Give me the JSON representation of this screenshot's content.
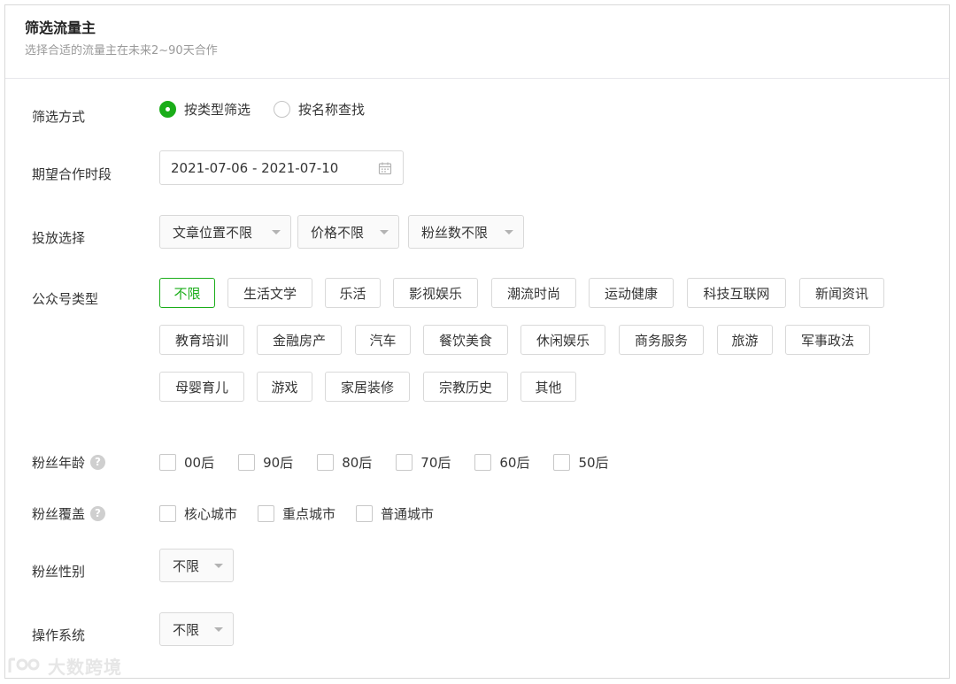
{
  "header": {
    "title": "筛选流量主",
    "subtitle": "选择合适的流量主在未来2~90天合作"
  },
  "filter_method": {
    "label": "筛选方式",
    "options": [
      {
        "label": "按类型筛选",
        "selected": true
      },
      {
        "label": "按名称查找",
        "selected": false
      }
    ]
  },
  "period": {
    "label": "期望合作时段",
    "value": "2021-07-06 - 2021-07-10",
    "icon": "calendar-icon"
  },
  "placement": {
    "label": "投放选择",
    "selects": [
      {
        "label": "文章位置不限"
      },
      {
        "label": "价格不限"
      },
      {
        "label": "粉丝数不限"
      }
    ]
  },
  "account_type": {
    "label": "公众号类型",
    "tags": [
      {
        "label": "不限",
        "active": true
      },
      {
        "label": "生活文学"
      },
      {
        "label": "乐活"
      },
      {
        "label": "影视娱乐"
      },
      {
        "label": "潮流时尚"
      },
      {
        "label": "运动健康"
      },
      {
        "label": "科技互联网"
      },
      {
        "label": "新闻资讯"
      },
      {
        "label": "教育培训"
      },
      {
        "label": "金融房产"
      },
      {
        "label": "汽车"
      },
      {
        "label": "餐饮美食"
      },
      {
        "label": "休闲娱乐"
      },
      {
        "label": "商务服务"
      },
      {
        "label": "旅游"
      },
      {
        "label": "军事政法"
      },
      {
        "label": "母婴育儿"
      },
      {
        "label": "游戏"
      },
      {
        "label": "家居装修"
      },
      {
        "label": "宗教历史"
      },
      {
        "label": "其他"
      }
    ]
  },
  "fan_age": {
    "label": "粉丝年龄",
    "help": "?",
    "options": [
      {
        "label": "00后",
        "checked": false
      },
      {
        "label": "90后",
        "checked": false
      },
      {
        "label": "80后",
        "checked": false
      },
      {
        "label": "70后",
        "checked": false
      },
      {
        "label": "60后",
        "checked": false
      },
      {
        "label": "50后",
        "checked": false
      }
    ]
  },
  "fan_coverage": {
    "label": "粉丝覆盖",
    "help": "?",
    "options": [
      {
        "label": "核心城市",
        "checked": false
      },
      {
        "label": "重点城市",
        "checked": false
      },
      {
        "label": "普通城市",
        "checked": false
      }
    ]
  },
  "fan_gender": {
    "label": "粉丝性别",
    "value": "不限"
  },
  "os": {
    "label": "操作系统",
    "value": "不限"
  },
  "watermark": {
    "text": "大数跨境"
  },
  "colors": {
    "accent": "#1aad19",
    "border": "#d9d9d9",
    "muted": "#9a9a9a"
  }
}
